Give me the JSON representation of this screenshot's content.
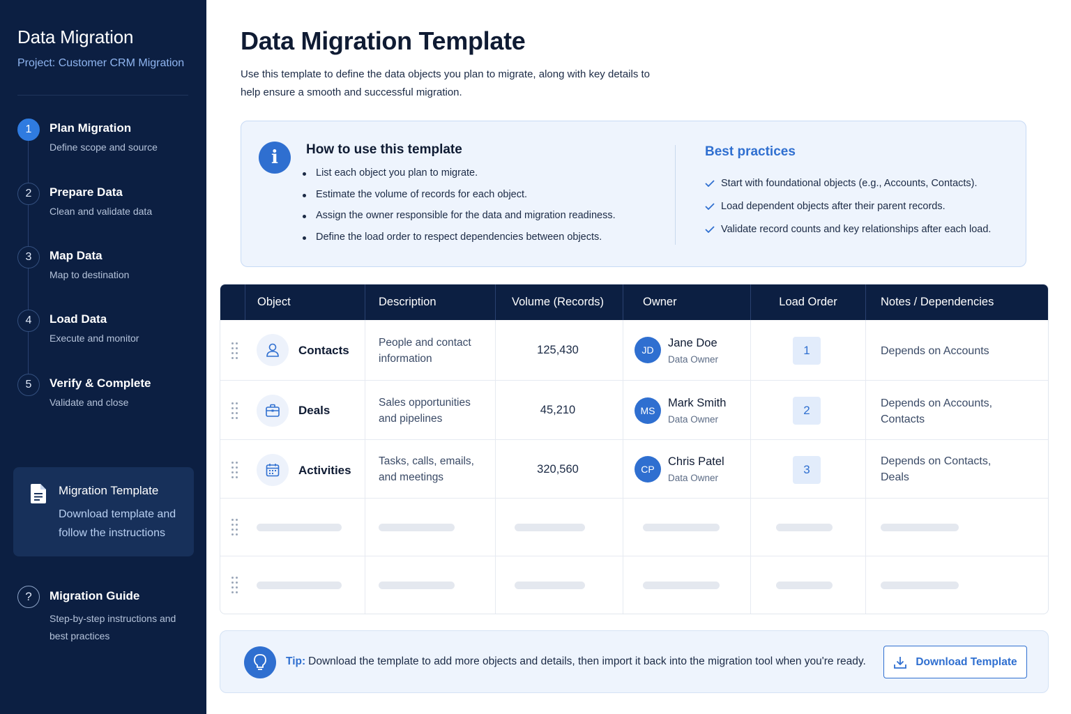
{
  "sidebar": {
    "title": "Data Migration",
    "project": "Project: Customer CRM Migration",
    "steps": [
      {
        "num": "1",
        "title": "Plan Migration",
        "subtitle": "Define scope and source"
      },
      {
        "num": "2",
        "title": "Prepare Data",
        "subtitle": "Clean and validate data"
      },
      {
        "num": "3",
        "title": "Map Data",
        "subtitle": "Map to destination"
      },
      {
        "num": "4",
        "title": "Load Data",
        "subtitle": "Execute and monitor"
      },
      {
        "num": "5",
        "title": "Verify & Complete",
        "subtitle": "Validate and close"
      }
    ],
    "active_step": 1,
    "template_card": {
      "title": "Migration Template",
      "subtitle": "Download template and follow the instructions",
      "icon": "document-icon"
    },
    "guide": {
      "icon": "?",
      "title": "Migration Guide",
      "subtitle": "Step-by-step instructions and best practices"
    }
  },
  "main": {
    "title": "Data Migration Template",
    "description": "Use this template to define the data objects you plan to migrate, along with key details to help ensure a smooth and successful migration.",
    "info": {
      "icon": "i",
      "how_title": "How to use this template",
      "how_items": [
        "List each object you plan to migrate.",
        "Estimate the volume of records for each object.",
        "Assign the owner responsible for the data and migration readiness.",
        "Define the load order to respect dependencies between objects."
      ],
      "best_title": "Best practices",
      "best_items": [
        "Start with foundational objects (e.g., Accounts, Contacts).",
        "Load dependent objects after their parent records.",
        "Validate record counts and key relationships after each load."
      ]
    },
    "table": {
      "columns": [
        "Object",
        "Description",
        "Volume (Records)",
        "Owner",
        "Load Order",
        "Notes / Dependencies"
      ],
      "rows": [
        {
          "icon": "person-icon",
          "object": "Contacts",
          "description": "People and contact information",
          "volume": "125,430",
          "owner_initials": "JD",
          "owner": "Jane Doe",
          "owner_role": "Data Owner",
          "load_order": "1",
          "notes": "Depends on Accounts"
        },
        {
          "icon": "briefcase-icon",
          "object": "Deals",
          "description": "Sales opportunities and pipelines",
          "volume": "45,210",
          "owner_initials": "MS",
          "owner": "Mark Smith",
          "owner_role": "Data Owner",
          "load_order": "2",
          "notes": "Depends on Accounts, Contacts"
        },
        {
          "icon": "calendar-icon",
          "object": "Activities",
          "description": "Tasks, calls, emails, and meetings",
          "volume": "320,560",
          "owner_initials": "CP",
          "owner": "Chris Patel",
          "owner_role": "Data Owner",
          "load_order": "3",
          "notes": "Depends on Contacts, Deals"
        }
      ],
      "placeholder_rows": 2
    },
    "tip": {
      "label": "Tip:",
      "text": "Download the template to add more objects and details, then import it back into the migration tool when you're ready.",
      "button": "Download Template"
    }
  },
  "colors": {
    "sidebar_bg": "#0c1f42",
    "accent": "#2f6fd0",
    "header_bg": "#0c1f42",
    "info_bg": "#eef4fd"
  }
}
